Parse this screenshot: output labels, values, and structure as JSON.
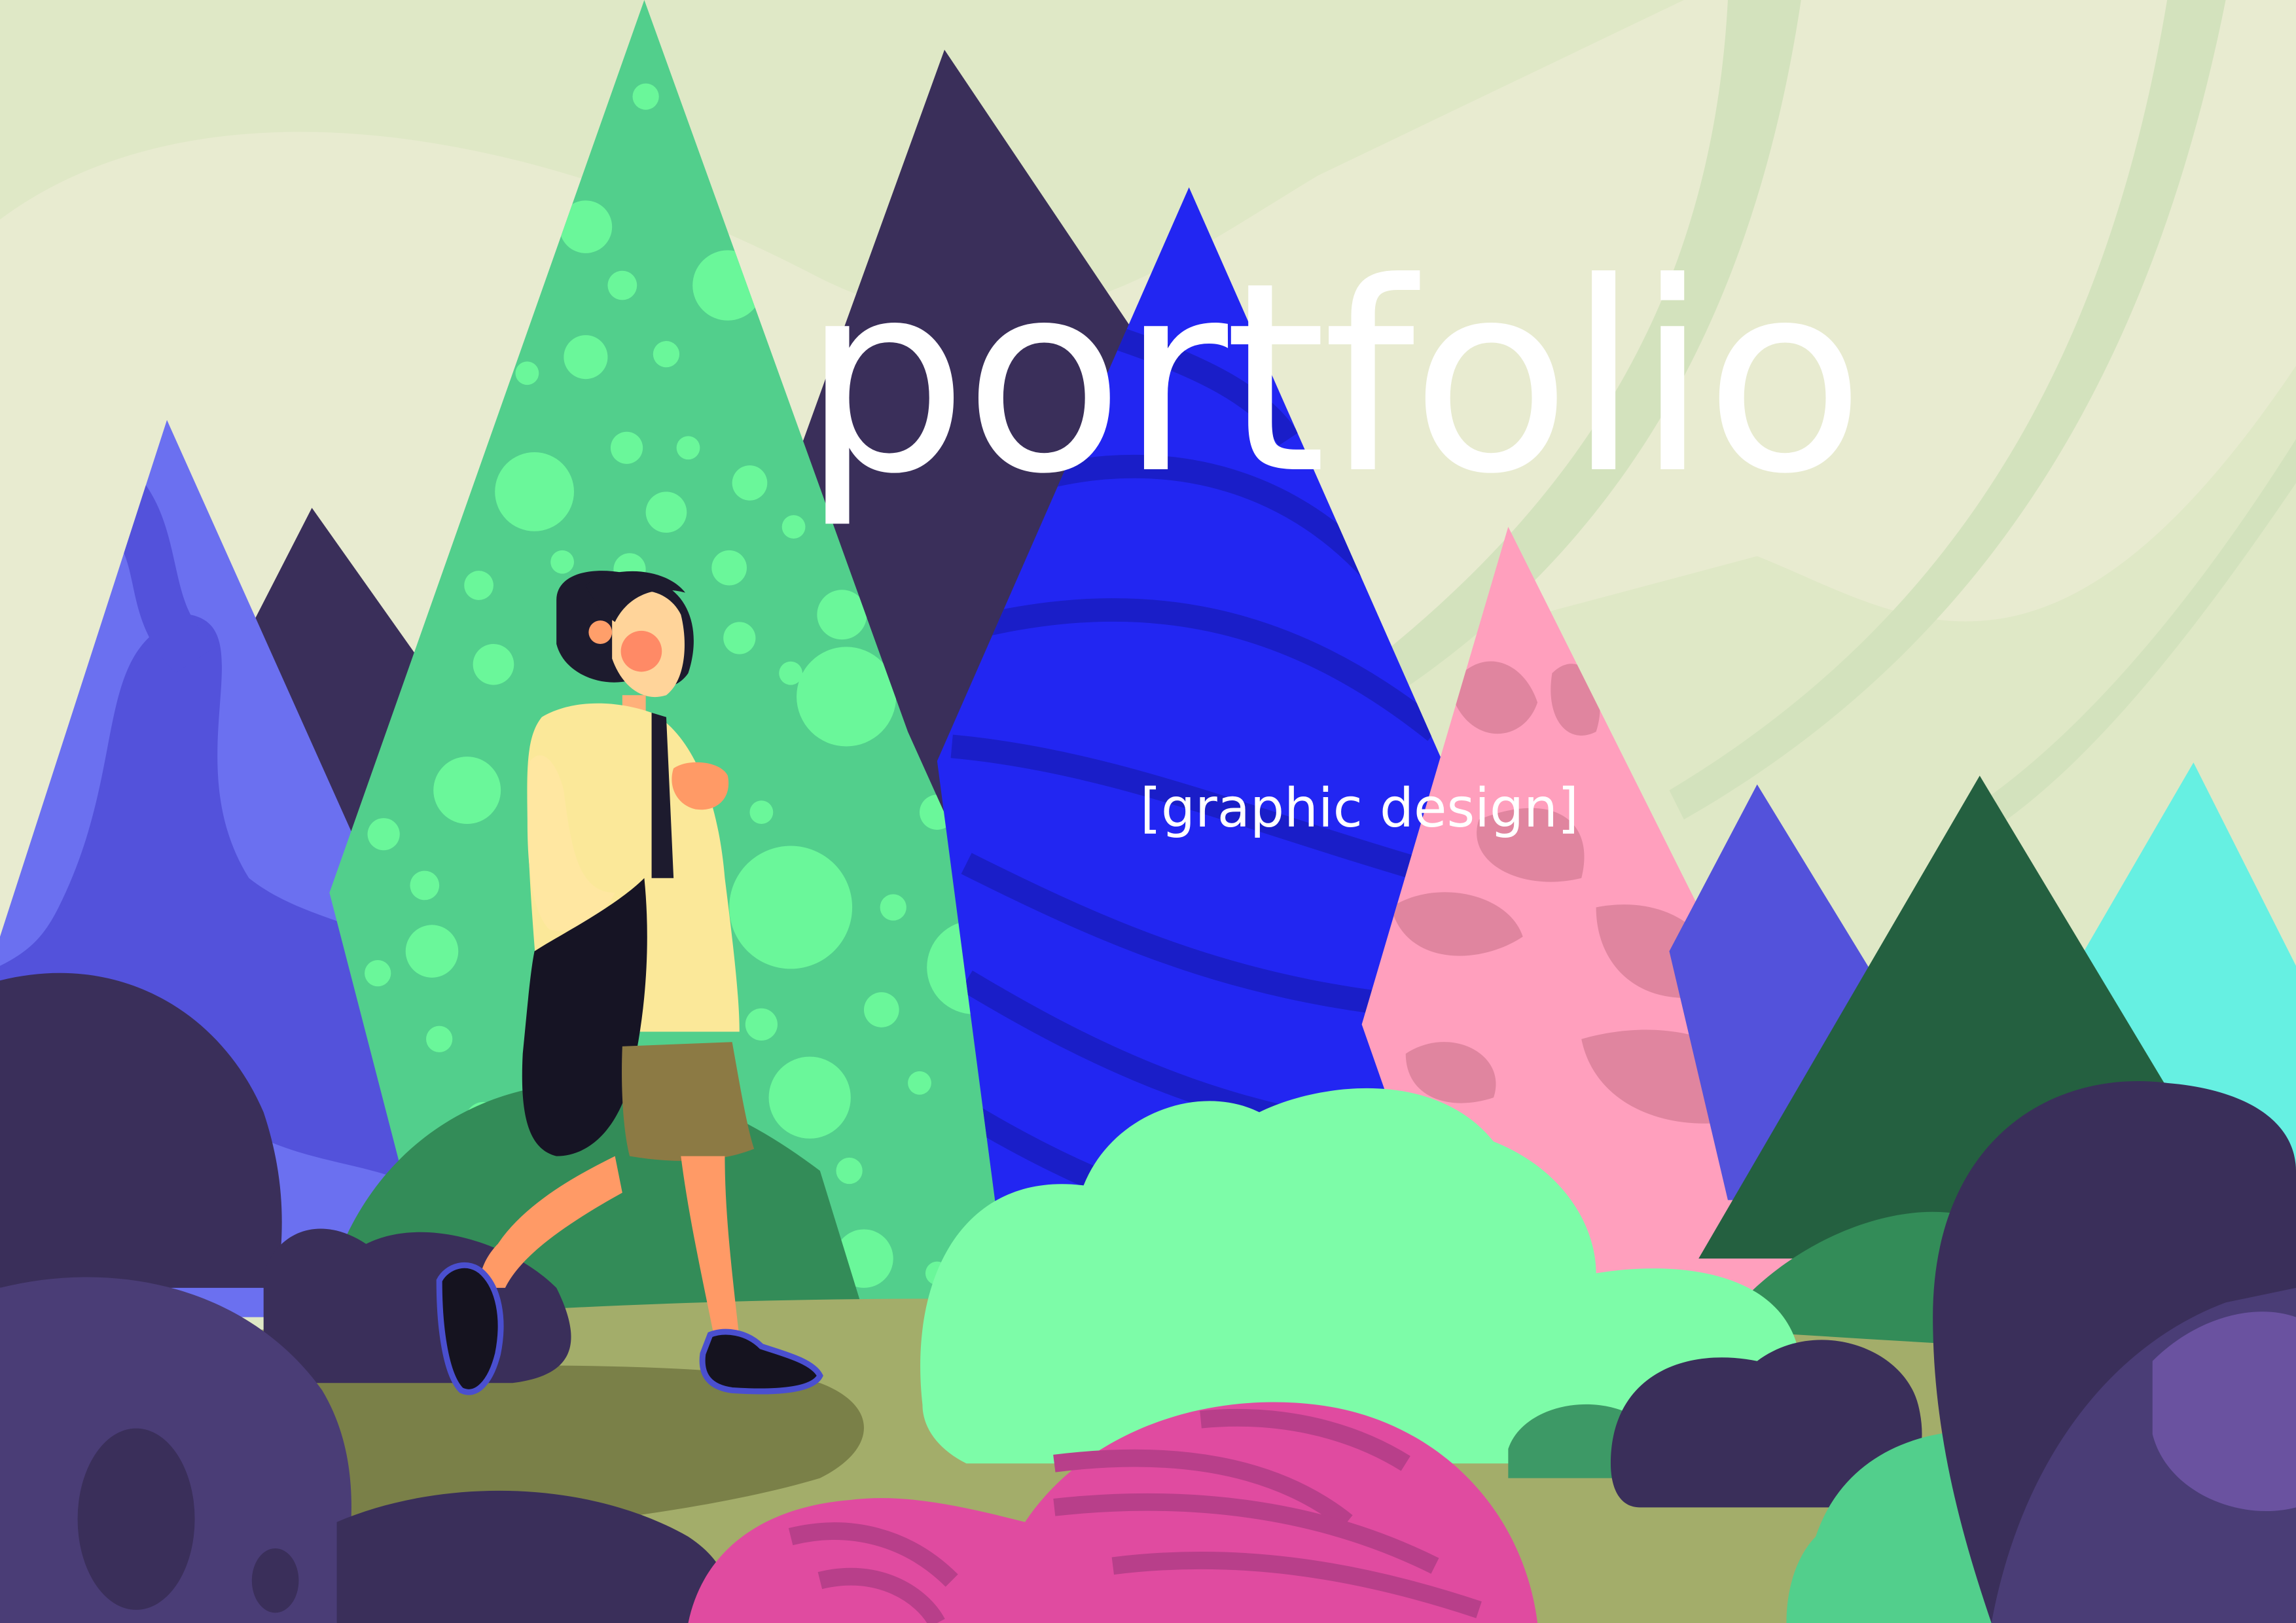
{
  "cover": {
    "title": "portfolio",
    "subtitle": "[graphic design]"
  },
  "palette": {
    "sky": "#dfe8c6",
    "sky_light": "#e9ecd2",
    "tree_green": "#52cf8c",
    "tree_dots": "#6af79a",
    "tree_navy": "#3a2f5a",
    "tree_blue": "#2226f2",
    "tree_periwinkle": "#6b70f0",
    "tree_pink": "#ff9fbd",
    "tree_dark_green": "#246040",
    "tree_cyan": "#66f0e2",
    "bush_mint": "#7dfca8",
    "bush_purple": "#4a3d76",
    "bush_magenta": "#e04ba0",
    "ground": "#a3ad6a"
  },
  "icons": [
    "tree-illustration",
    "bush-illustration",
    "walking-girl-illustration"
  ]
}
